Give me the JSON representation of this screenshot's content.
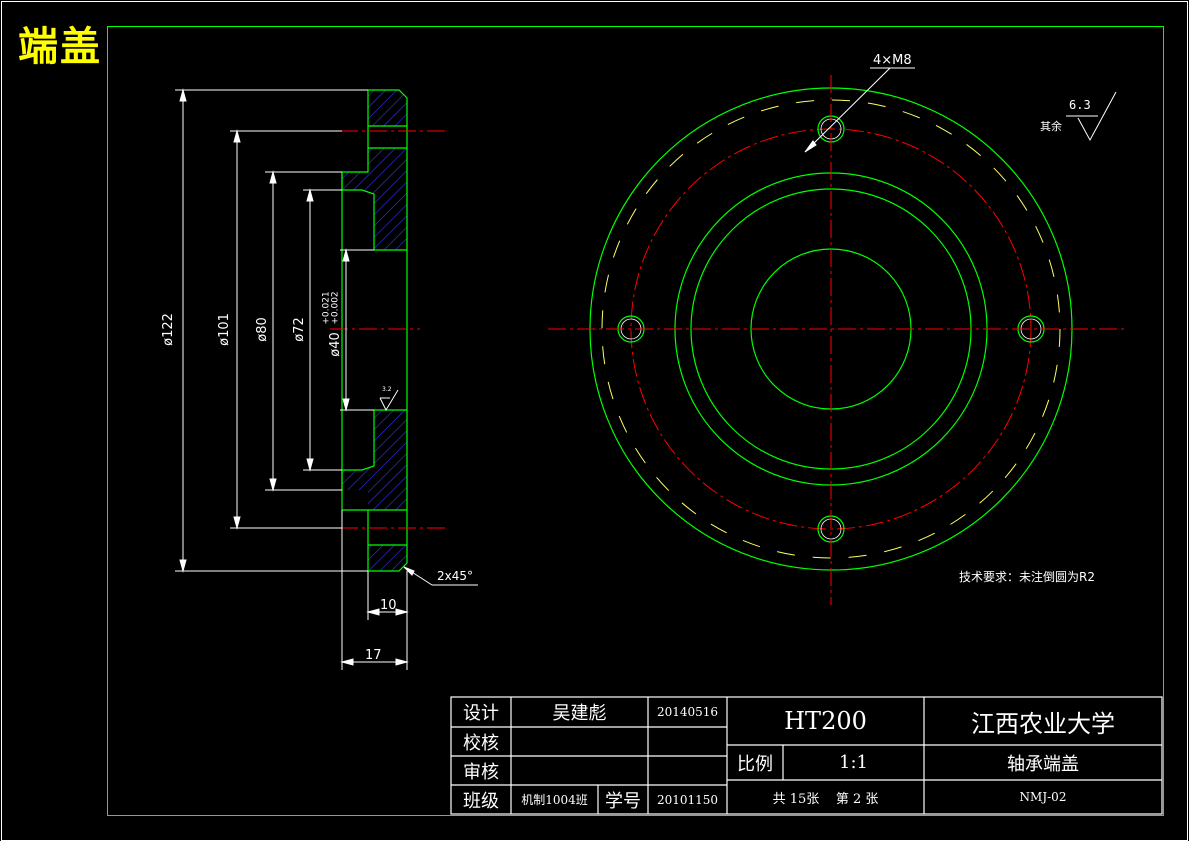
{
  "title_tag": "端盖",
  "colors": {
    "frame": "#00ff00",
    "centerline": "#ff0000",
    "dim": "#ffffff",
    "hatch": "#3333ff",
    "accent": "#ffff00",
    "hidden": "#ffff66"
  },
  "section_view": {
    "dim_d122": "ø122",
    "dim_d101": "ø101",
    "dim_d80": "ø80",
    "dim_d72": "ø72",
    "dim_d40": "ø40",
    "dim_d40_tol_upper": "+0.021",
    "dim_d40_tol_lower": "+0.002",
    "dim_10": "10",
    "dim_17": "17",
    "chamfer": "2x45°",
    "roughness_small": "3.2"
  },
  "front_view": {
    "holes_label": "4×M8"
  },
  "roughness": {
    "label": "其余",
    "value": "6.3"
  },
  "technical_requirement": "技术要求：未注倒圆为R2",
  "title_block": {
    "design_label": "设计",
    "designer": "吴建彪",
    "design_date": "20140516",
    "check_label": "校核",
    "review_label": "审核",
    "class_label": "班级",
    "class_value": "机制1004班",
    "student_id_label": "学号",
    "student_id": "20101150",
    "material": "HT200",
    "school": "江西农业大学",
    "scale_label": "比例",
    "scale_value": "1:1",
    "part_name": "轴承端盖",
    "sheets": "共 15张    第 2 张",
    "drawing_no": "NMJ-02"
  }
}
